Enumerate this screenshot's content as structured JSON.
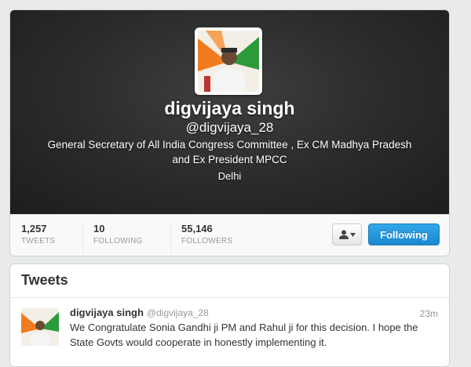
{
  "profile": {
    "name": "digvijaya singh",
    "handle": "@digvijaya_28",
    "bio": "General Secretary of All India Congress Committee , Ex CM Madhya Pradesh and Ex President MPCC",
    "location": "Delhi",
    "avatar_icon": "profile-photo"
  },
  "stats": [
    {
      "value": "1,257",
      "label": "TWEETS"
    },
    {
      "value": "10",
      "label": "FOLLOWING"
    },
    {
      "value": "55,146",
      "label": "FOLLOWERS"
    }
  ],
  "actions": {
    "user_menu_icon": "user-dropdown-icon",
    "follow_label": "Following"
  },
  "tweets": {
    "title": "Tweets",
    "items": [
      {
        "name": "digvijaya singh",
        "handle": "@digvijaya_28",
        "time": "23m",
        "text": "We Congratulate Sonia Gandhi ji PM and Rahul ji for this decision. I hope the State Govts would cooperate in honestly implementing it."
      }
    ]
  },
  "colors": {
    "follow_button": "#1b88d0",
    "banner": "#2a2a2a"
  }
}
